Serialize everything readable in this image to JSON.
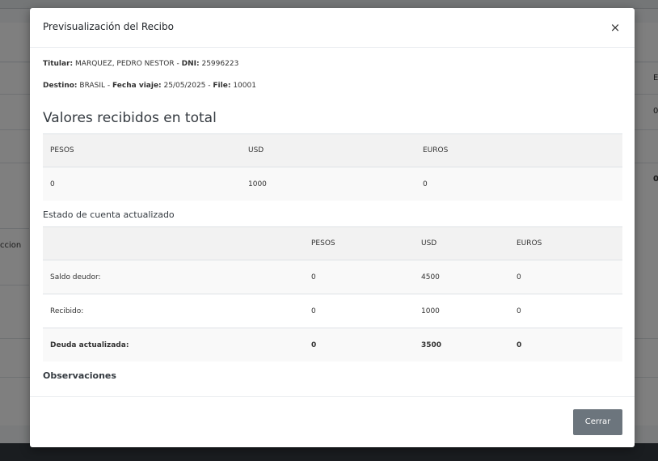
{
  "background": {
    "row_label": "ccion",
    "col_header_fragment": "E",
    "cell_fragment_1": "0",
    "cell_fragment_2": "0"
  },
  "modal": {
    "title": "Previsualización del Recibo",
    "close_symbol": "×",
    "info_line_1": {
      "titular_label": "Titular:",
      "titular_value": "MARQUEZ, PEDRO NESTOR",
      "sep": "-",
      "dni_label": "DNI:",
      "dni_value": "25996223"
    },
    "info_line_2": {
      "destino_label": "Destino:",
      "destino_value": "BRASIL",
      "sep1": "-",
      "fecha_label": "Fecha viaje:",
      "fecha_value": "25/05/2025",
      "sep2": "-",
      "file_label": "File:",
      "file_value": "10001"
    },
    "total_heading": "Valores recibidos en total",
    "total_table": {
      "headers": [
        "PESOS",
        "USD",
        "EUROS"
      ],
      "row": [
        "0",
        "1000",
        "0"
      ]
    },
    "estado_heading": "Estado de cuenta actualizado",
    "estado_table": {
      "headers": [
        "",
        "PESOS",
        "USD",
        "EUROS"
      ],
      "rows": [
        [
          "Saldo deudor:",
          "0",
          "4500",
          "0"
        ],
        [
          "Recibido:",
          "0",
          "1000",
          "0"
        ],
        [
          "Deuda actualizada:",
          "0",
          "3500",
          "0"
        ]
      ]
    },
    "observaciones_heading": "Observaciones",
    "close_button_label": "Cerrar"
  }
}
